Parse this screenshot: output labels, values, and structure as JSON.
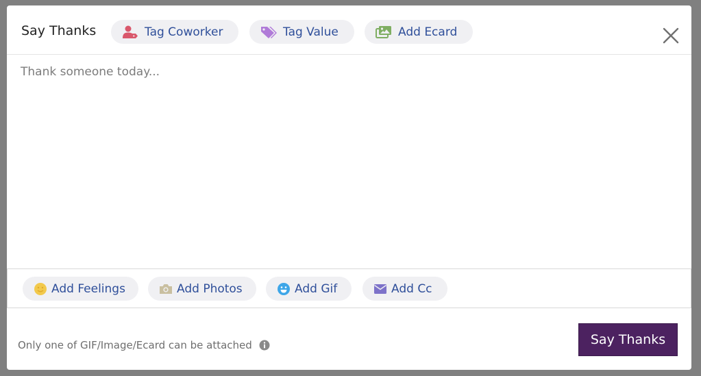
{
  "header": {
    "title": "Say Thanks",
    "actions": [
      {
        "label": "Tag Coworker",
        "icon": "user-tag-icon",
        "color": "#d9576b"
      },
      {
        "label": "Tag Value",
        "icon": "tags-icon",
        "color": "#b07bd8"
      },
      {
        "label": "Add Ecard",
        "icon": "images-icon",
        "color": "#7fae62"
      }
    ]
  },
  "editor": {
    "placeholder": "Thank someone today...",
    "value": ""
  },
  "toolbar": {
    "actions": [
      {
        "label": "Add Feelings",
        "icon": "smile-icon",
        "color": "#f2c94c"
      },
      {
        "label": "Add Photos",
        "icon": "camera-icon",
        "color": "#c9bfa0"
      },
      {
        "label": "Add Gif",
        "icon": "grin-icon",
        "color": "#3ea6e8"
      },
      {
        "label": "Add Cc",
        "icon": "envelope-icon",
        "color": "#7d72c9"
      }
    ]
  },
  "footer": {
    "note": "Only one of GIF/Image/Ecard can be attached",
    "submit_label": "Say Thanks"
  },
  "colors": {
    "accent": "#4c2260",
    "pill_text": "#2f4f9a",
    "pill_bg": "#f0f0f3"
  }
}
